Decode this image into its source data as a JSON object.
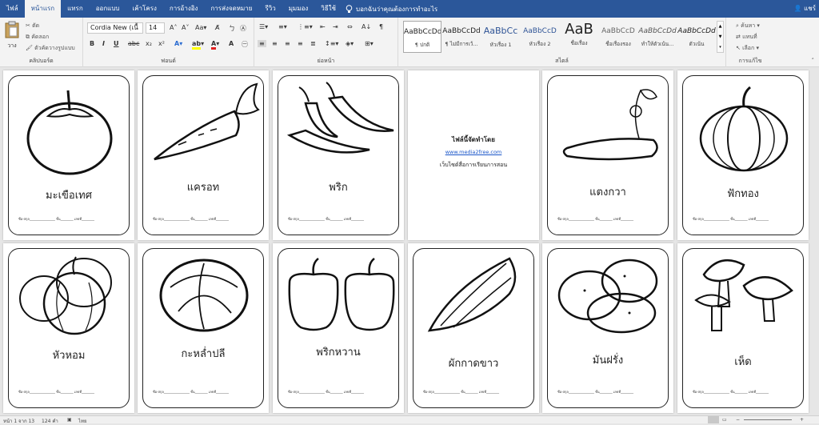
{
  "tabs": [
    "ไฟล์",
    "หน้าแรก",
    "แทรก",
    "ออกแบบ",
    "เค้าโครง",
    "การอ้างอิง",
    "การส่งจดหมาย",
    "รีวิว",
    "มุมมอง",
    "วิธีใช้"
  ],
  "tell_me": "บอกฉันว่าคุณต้องการทำอะไร",
  "user": "แชร์",
  "clipboard": {
    "paste": "วาง",
    "cut": "ตัด",
    "copy": "คัดลอก",
    "painter": "ตัวคัดวางรูปแบบ",
    "label": "คลิปบอร์ด"
  },
  "font": {
    "name": "Cordia New (เนื้",
    "size": "14",
    "label": "ฟอนต์"
  },
  "paragraph": {
    "label": "ย่อหน้า"
  },
  "styles": {
    "label": "สไตล์",
    "items": [
      {
        "preview": "AaBbCcDd",
        "name": "¶ ปกติ"
      },
      {
        "preview": "AaBbCcDd",
        "name": "¶ ไม่มีการเว้..."
      },
      {
        "preview": "AaBbCc",
        "name": "หัวเรื่อง 1"
      },
      {
        "preview": "AaBbCcD",
        "name": "หัวเรื่อง 2"
      },
      {
        "preview": "AaB",
        "name": "ชื่อเรื่อง"
      },
      {
        "preview": "AaBbCcD",
        "name": "ชื่อเรื่องรอง"
      },
      {
        "preview": "AaBbCcDd",
        "name": "ทำให้ตัวเน้น..."
      },
      {
        "preview": "AaBbCcDd",
        "name": "ตัวเน้น"
      }
    ]
  },
  "editing": {
    "find": "ค้นหา",
    "replace": "แทนที่",
    "select": "เลือก",
    "label": "การแก้ไข"
  },
  "cards_row1": [
    "มะเขือเทศ",
    "แครอท",
    "พริก",
    "",
    "แตงกวา",
    "ฟักทอง"
  ],
  "cards_row2": [
    "หัวหอม",
    "กะหล่ำปลี",
    "พริกหวาน",
    "ผักกาดขาว",
    "มันฝรั่ง",
    "เห็ด"
  ],
  "card_line": "ชื่อ-สกุล________________ ชั้น________ เลขที่________",
  "info_card": {
    "title": "ไฟล์นี้จัดทำโดย",
    "url": "www.media2free.com",
    "desc": "เว็บไซต์สื่อการเรียนการสอน"
  },
  "status": {
    "page": "หน้า 1 จาก 13",
    "words": "124 คำ",
    "lang": "ไทย"
  }
}
